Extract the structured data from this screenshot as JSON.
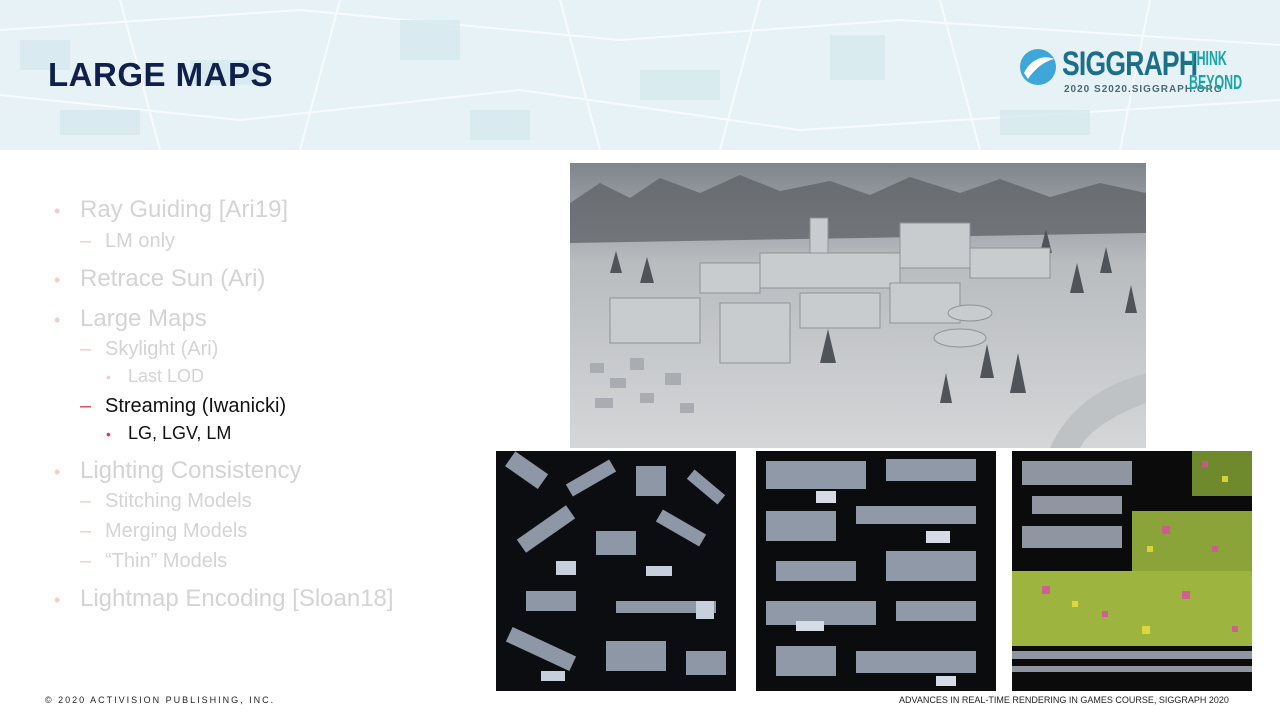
{
  "slide": {
    "title": "LARGE MAPS"
  },
  "logo": {
    "name": "SIGGRAPH",
    "sub": "2020  S2020.SIGGRAPH.ORG",
    "tagline_1": "THINK",
    "tagline_2": "BEYOND"
  },
  "outline": [
    {
      "text": "Ray Guiding [Ari19]",
      "marker": "•"
    },
    {
      "text": "LM only",
      "marker": "–"
    },
    {
      "text": "Retrace Sun (Ari)",
      "marker": "•"
    },
    {
      "text": "Large Maps",
      "marker": "•"
    },
    {
      "text": "Skylight (Ari)",
      "marker": "–"
    },
    {
      "text": "Last LOD",
      "marker": "•"
    },
    {
      "text": "Streaming (Iwanicki)",
      "marker": "–"
    },
    {
      "text": "LG, LGV, LM",
      "marker": "•"
    },
    {
      "text": "Lighting Consistency",
      "marker": "•"
    },
    {
      "text": "Stitching Models",
      "marker": "–"
    },
    {
      "text": "Merging Models",
      "marker": "–"
    },
    {
      "text": "“Thin” Models",
      "marker": "–"
    },
    {
      "text": "Lightmap Encoding [Sloan18]",
      "marker": "•"
    }
  ],
  "footer": {
    "copyright": "© 2020 ACTIVISION PUBLISHING, INC.",
    "course": "ADVANCES IN REAL-TIME RENDERING IN GAMES COURSE, SIGGRAPH 2020"
  }
}
